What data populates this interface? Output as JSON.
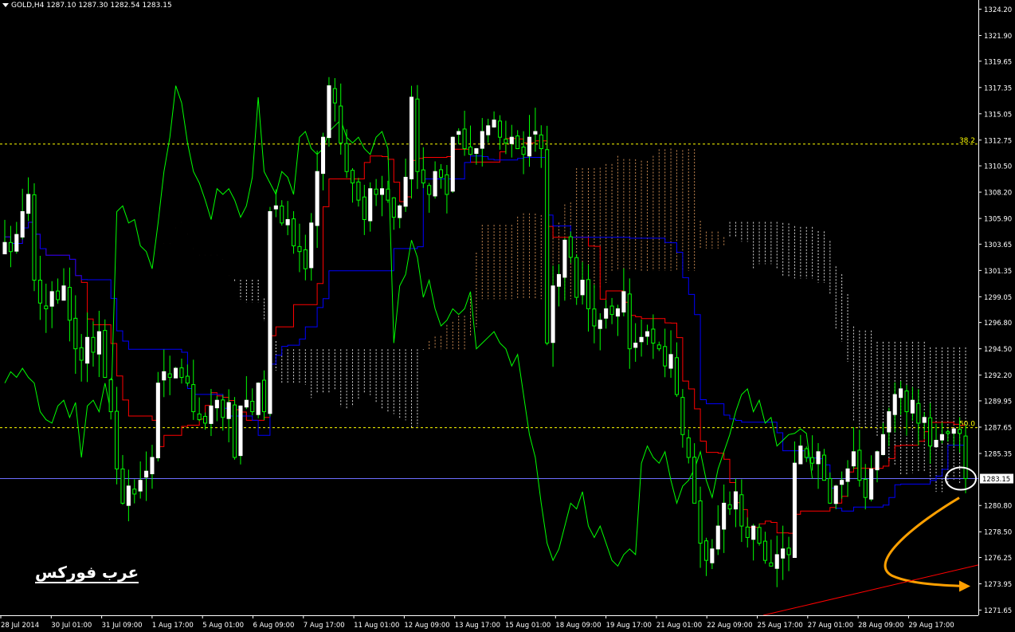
{
  "header": {
    "symbol": "GOLD,H4",
    "ohlc": "1287.10 1287.30 1282.54 1283.15"
  },
  "watermark": "عرب فوركس",
  "colors": {
    "background": "#000000",
    "axis": "#ffffff",
    "bull_candle": "#ffffff",
    "bear_candle": "#00c000",
    "wick": "#00ff00",
    "tenkan": "#ff0000",
    "kijun": "#0000ff",
    "chikou": "#00ff00",
    "cloud_bull": "#e8a060",
    "cloud_bear": "#ffffff",
    "fib": "#ffff00",
    "bid_line": "#6e6eff",
    "arrow": "#ffa000",
    "trendline": "#ff0000"
  },
  "chart_data": {
    "type": "candlestick",
    "y_ticks": [
      "1324.20",
      "1321.90",
      "1319.65",
      "1317.35",
      "1315.05",
      "1312.75",
      "1310.50",
      "1308.20",
      "1305.90",
      "1303.65",
      "1301.35",
      "1299.05",
      "1296.80",
      "1294.50",
      "1292.20",
      "1289.95",
      "1287.65",
      "1285.35",
      "1283.15",
      "1280.80",
      "1278.50",
      "1276.25",
      "1273.95",
      "1271.65"
    ],
    "ylim": [
      1271.2,
      1325.0
    ],
    "x_labels": [
      "28 Jul 2014",
      "30 Jul 01:00",
      "31 Jul 09:00",
      "1 Aug 17:00",
      "5 Aug 01:00",
      "6 Aug 09:00",
      "7 Aug 17:00",
      "11 Aug 01:00",
      "12 Aug 09:00",
      "13 Aug 17:00",
      "15 Aug 01:00",
      "18 Aug 09:00",
      "19 Aug 17:00",
      "21 Aug 01:00",
      "22 Aug 09:00",
      "25 Aug 17:00",
      "27 Aug 01:00",
      "28 Aug 09:00",
      "29 Aug 17:00"
    ],
    "current_price": "1283.15",
    "current_price_value": 1283.15,
    "fib_levels": [
      {
        "label": "38.2",
        "value": 1312.4
      },
      {
        "label": "50.0",
        "value": 1287.6
      }
    ],
    "closes": [
      1303.8,
      1303.0,
      1304.5,
      1306.5,
      1308.0,
      1300.5,
      1298.5,
      1298.0,
      1299.5,
      1298.8,
      1300.0,
      1297.0,
      1294.5,
      1293.5,
      1295.5,
      1294.2,
      1296.0,
      1292.0,
      1289.0,
      1284.0,
      1281.0,
      1282.5,
      1281.8,
      1283.0,
      1283.8,
      1285.0,
      1291.5,
      1292.5,
      1292.0,
      1292.8,
      1292.0,
      1291.5,
      1289.0,
      1288.3,
      1288.0,
      1289.5,
      1290.0,
      1288.5,
      1289.8,
      1285.0,
      1289.5,
      1290.0,
      1289.0,
      1291.5,
      1289.0,
      1306.5,
      1307.0,
      1305.5,
      1305.8,
      1303.5,
      1303.0,
      1301.5,
      1305.5,
      1310.0,
      1313.0,
      1317.5,
      1316.0,
      1312.5,
      1310.0,
      1309.0,
      1307.5,
      1305.8,
      1308.5,
      1308.0,
      1308.5,
      1307.5,
      1306.0,
      1307.0,
      1309.5,
      1316.5,
      1310.0,
      1309.0,
      1308.0,
      1310.0,
      1309.5,
      1308.0,
      1313.0,
      1313.5,
      1312.0,
      1311.5,
      1312.0,
      1313.5,
      1314.0,
      1314.5,
      1313.0,
      1312.5,
      1313.0,
      1312.0,
      1311.5,
      1313.0,
      1313.5,
      1312.0,
      1295.0,
      1300.0,
      1301.0,
      1304.0,
      1302.5,
      1299.0,
      1300.5,
      1298.0,
      1296.5,
      1297.0,
      1298.0,
      1297.5,
      1298.0,
      1299.5,
      1294.5,
      1295.0,
      1295.5,
      1296.0,
      1295.0,
      1294.5,
      1293.0,
      1294.0,
      1290.5,
      1287.0,
      1285.0,
      1281.0,
      1277.5,
      1276.0,
      1277.0,
      1279.0,
      1281.0,
      1280.5,
      1282.0,
      1279.0,
      1278.0,
      1279.0,
      1277.5,
      1276.0,
      1275.5,
      1276.5,
      1277.0,
      1276.5,
      1284.5,
      1286.0,
      1285.0,
      1284.5,
      1285.5,
      1283.0,
      1281.0,
      1282.5,
      1283.0,
      1284.0,
      1285.5,
      1283.0,
      1281.5,
      1284.0,
      1285.5,
      1287.0,
      1289.0,
      1290.5,
      1291.0,
      1289.0,
      1290.0,
      1288.0,
      1288.5,
      1286.0,
      1286.5,
      1287.0,
      1287.1,
      1287.5,
      1287.1,
      1283.15
    ]
  }
}
